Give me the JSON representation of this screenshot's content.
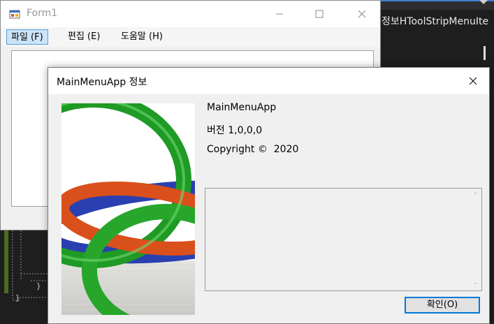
{
  "ide": {
    "tab_text": "정보HToolStripMenuIte"
  },
  "form1": {
    "title": "Form1",
    "menu": [
      {
        "label": "파일 (F)"
      },
      {
        "label": "편집 (E)"
      },
      {
        "label": "도움말 (H)"
      }
    ]
  },
  "about": {
    "title": "MainMenuApp 정보",
    "product": "MainMenuApp",
    "version": "버전 1,0,0,0",
    "copyright": "Copyright ©  2020",
    "ok_label": "확인(O)"
  },
  "icons": {
    "minimize": "minimize-icon",
    "maximize": "maximize-icon",
    "close": "close-icon",
    "app": "form-app-icon"
  },
  "colors": {
    "accent": "#0078d7",
    "menu_highlight": "#cce4f7",
    "ide_background": "#1e1e1e"
  }
}
